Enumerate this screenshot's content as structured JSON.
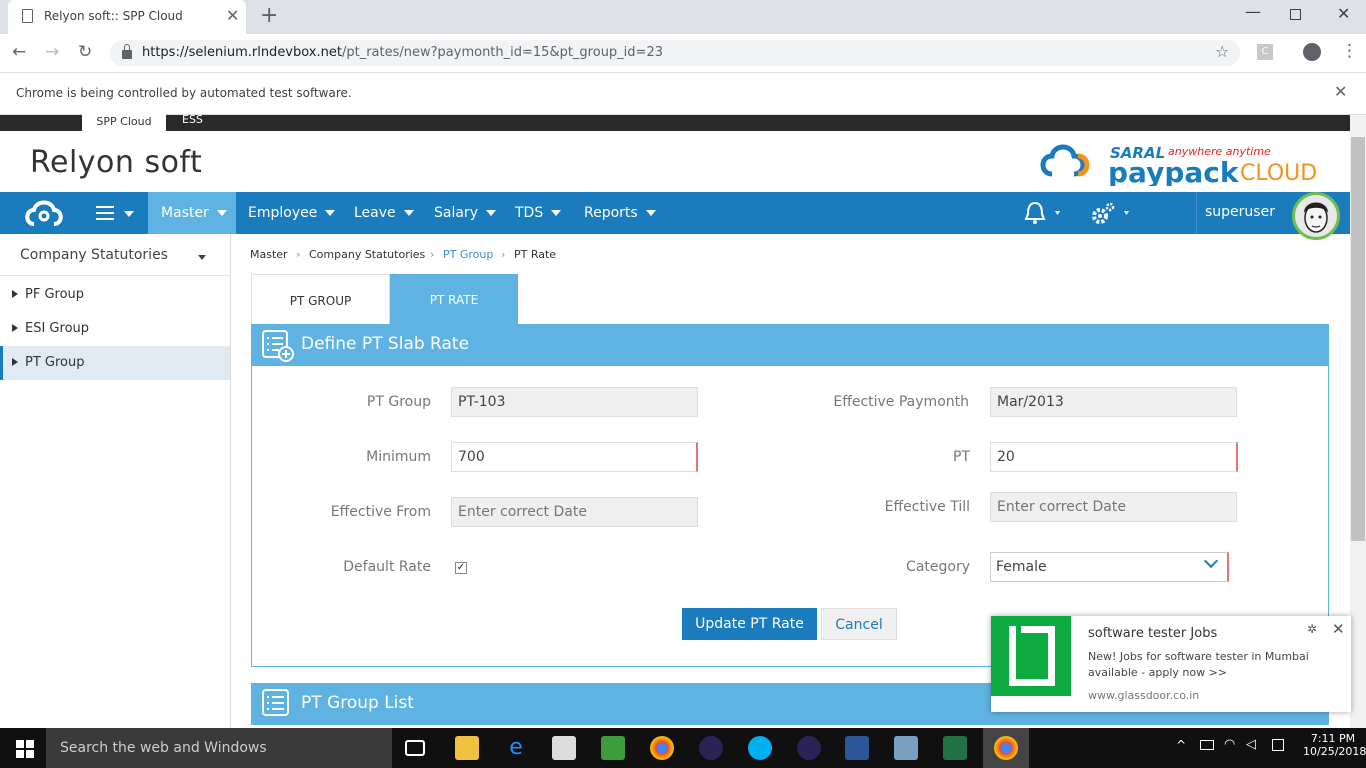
{
  "browser": {
    "tab_title": "Relyon soft:: SPP Cloud",
    "url_host": "https://selenium.rlndevbox.net",
    "url_path": "/pt_rates/new?paymonth_id=15&pt_group_id=23",
    "infobar_text": "Chrome is being controlled by automated test software.",
    "ext_label": "C"
  },
  "app": {
    "top_tabs": [
      "SPP Cloud",
      "ESS"
    ],
    "brand": "Relyon soft",
    "logo": {
      "saral": "SARAL",
      "tagline": "anywhere anytime",
      "paypack": "paypack",
      "cloud": "CLOUD"
    },
    "menu": [
      "Master",
      "Employee",
      "Leave",
      "Salary",
      "TDS",
      "Reports"
    ],
    "username": "superuser"
  },
  "sidebar": {
    "header": "Company Statutories",
    "items": [
      "PF Group",
      "ESI Group",
      "PT Group"
    ]
  },
  "breadcrumb": [
    "Master",
    "Company Statutories",
    "PT Group",
    "PT Rate"
  ],
  "form_tabs": [
    "PT GROUP",
    "PT RATE"
  ],
  "form": {
    "title": "Define PT Slab Rate",
    "pt_group_label": "PT Group",
    "pt_group_value": "PT-103",
    "eff_paymonth_label": "Effective Paymonth",
    "eff_paymonth_value": "Mar/2013",
    "minimum_label": "Minimum",
    "minimum_value": "700",
    "pt_label": "PT",
    "pt_value": "20",
    "eff_from_label": "Effective From",
    "eff_from_placeholder": "Enter correct Date",
    "eff_till_label": "Effective Till",
    "eff_till_placeholder": "Enter correct Date",
    "default_rate_label": "Default Rate",
    "default_rate_checked": true,
    "category_label": "Category",
    "category_value": "Female",
    "update_button": "Update PT Rate",
    "cancel_button": "Cancel"
  },
  "list": {
    "title": "PT Group List"
  },
  "notification": {
    "title": "software tester Jobs",
    "body": "New! Jobs for software tester in Mumbai available - apply now >>",
    "source": "www.glassdoor.co.in"
  },
  "taskbar": {
    "search_text": "Search the web and Windows",
    "time": "7:11 PM",
    "date": "10/25/2018"
  },
  "colors": {
    "primary": "#1a7cbd",
    "light": "#5fb3e2",
    "glassdoor": "#0caa41"
  }
}
